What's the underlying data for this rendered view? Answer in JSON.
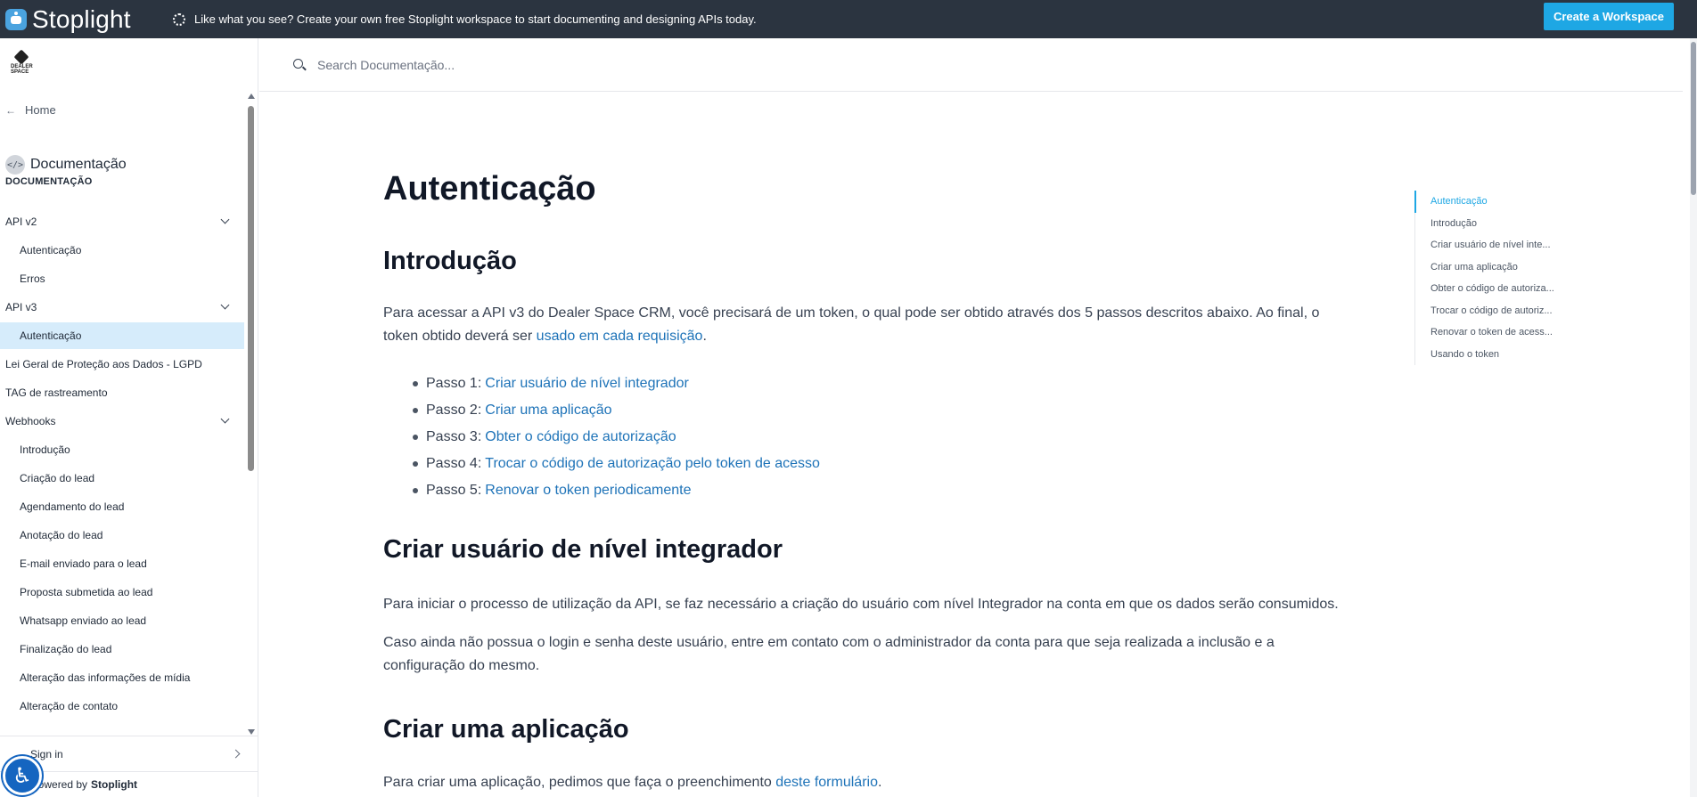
{
  "banner": {
    "brand": "Stoplight",
    "message": "Like what you see? Create your own free Stoplight workspace to start documenting and designing APIs today.",
    "cta": "Create a Workspace"
  },
  "sidebar": {
    "logo_text": "DEALER SPACE",
    "home": "Home",
    "project": "Documentação",
    "section_title": "DOCUMENTAÇÃO",
    "items": [
      {
        "label": "API v2",
        "type": "group"
      },
      {
        "label": "Autenticação",
        "type": "child"
      },
      {
        "label": "Erros",
        "type": "child"
      },
      {
        "label": "API v3",
        "type": "group"
      },
      {
        "label": "Autenticação",
        "type": "child",
        "active": true
      },
      {
        "label": "Lei Geral de Proteção aos Dados - LGPD",
        "type": "top"
      },
      {
        "label": "TAG de rastreamento",
        "type": "top"
      },
      {
        "label": "Webhooks",
        "type": "group"
      },
      {
        "label": "Introdução",
        "type": "child"
      },
      {
        "label": "Criação do lead",
        "type": "child"
      },
      {
        "label": "Agendamento do lead",
        "type": "child"
      },
      {
        "label": "Anotação do lead",
        "type": "child"
      },
      {
        "label": "E-mail enviado para o lead",
        "type": "child"
      },
      {
        "label": "Proposta submetida ao lead",
        "type": "child"
      },
      {
        "label": "Whatsapp enviado ao lead",
        "type": "child"
      },
      {
        "label": "Finalização do lead",
        "type": "child"
      },
      {
        "label": "Alteração das informações de mídia",
        "type": "child"
      },
      {
        "label": "Alteração de contato",
        "type": "child"
      }
    ],
    "sign_in": "Sign in",
    "powered_prefix": "powered by",
    "powered_brand": "Stoplight"
  },
  "search": {
    "placeholder": "Search Documentação..."
  },
  "article": {
    "title": "Autenticação",
    "intro_heading": "Introdução",
    "intro_text": "Para acessar a API v3 do Dealer Space CRM, você precisará de um token, o qual pode ser obtido através dos 5 passos descritos abaixo. Ao final, o token obtido deverá ser ",
    "intro_link": "usado em cada requisição",
    "intro_end": ".",
    "steps": [
      {
        "prefix": "Passo 1:",
        "link": "Criar usuário de nível integrador"
      },
      {
        "prefix": "Passo 2:",
        "link": "Criar uma aplicação"
      },
      {
        "prefix": "Passo 3:",
        "link": "Obter o código de autorização"
      },
      {
        "prefix": "Passo 4:",
        "link": "Trocar o código de autorização pelo token de acesso"
      },
      {
        "prefix": "Passo 5:",
        "link": "Renovar o token periodicamente"
      }
    ],
    "integrator_heading": "Criar usuário de nível integrador",
    "integrator_p1": "Para iniciar o processo de utilização da API, se faz necessário a criação do usuário com nível Integrador na conta em que os dados serão consumidos.",
    "integrator_p2": "Caso ainda não possua o login e senha deste usuário, entre em contato com o administrador da conta para que seja realizada a inclusão e a configuração do mesmo.",
    "app_heading": "Criar uma aplicação",
    "app_text": "Para criar uma aplicação, pedimos que faça o preenchimento ",
    "app_link": "deste formulário",
    "app_end": "."
  },
  "toc": {
    "items": [
      {
        "label": "Autenticação",
        "active": true
      },
      {
        "label": "Introdução"
      },
      {
        "label": "Criar usuário de nível inte..."
      },
      {
        "label": "Criar uma aplicação"
      },
      {
        "label": "Obter o código de autoriza..."
      },
      {
        "label": "Trocar o código de autoriz..."
      },
      {
        "label": "Renovar o token de acess..."
      },
      {
        "label": "Usando o token"
      }
    ]
  }
}
